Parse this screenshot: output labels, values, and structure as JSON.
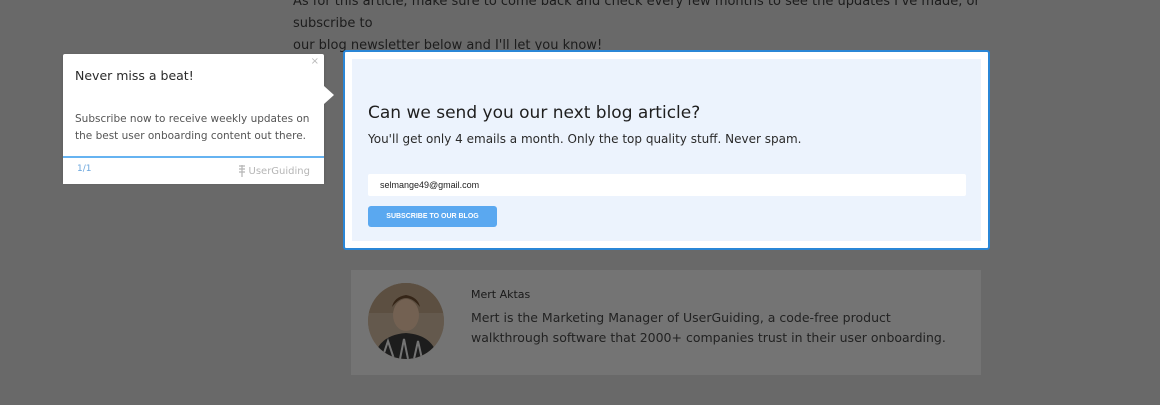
{
  "article": {
    "line1": "As for this article, make sure to come back and check every few months to see the updates I've made, or subscribe to",
    "line2": "our blog newsletter below and I'll let you know!"
  },
  "subscribe": {
    "title": "Can we send you our next blog article?",
    "description": "You'll get only 4 emails a month. Only the top quality stuff. Never spam.",
    "email_value": "selmange49@gmail.com",
    "button_label": "SUBSCRIBE TO OUR BLOG"
  },
  "tooltip": {
    "close_symbol": "×",
    "title": "Never miss a beat!",
    "body": "Subscribe now to receive weekly updates on the best user onboarding content out there.",
    "step": "1/1",
    "brand": "UserGuiding"
  },
  "author": {
    "name": "Mert Aktas",
    "bio": "Mert is the Marketing Manager of UserGuiding, a code-free product walkthrough software that 2000+ companies trust in their user onboarding."
  },
  "colors": {
    "highlight_border": "#2a86d6",
    "button_bg": "#5aa8f0",
    "card_bg": "#ecf3fd"
  },
  "icons": [
    "userguiding-logo-icon",
    "close-icon"
  ]
}
